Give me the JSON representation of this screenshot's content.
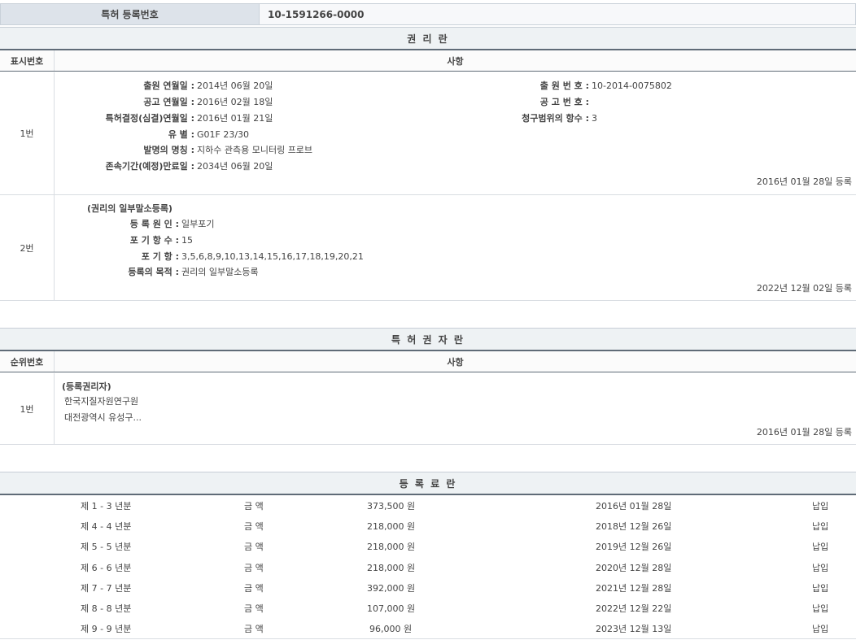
{
  "header": {
    "label": "특허 등록번호",
    "value": "10-1591266-0000"
  },
  "rights": {
    "title": "권 리 란",
    "col1": "표시번호",
    "col2": "사항",
    "entry1": {
      "num": "1번",
      "left": [
        {
          "k": "출원 연월일 :",
          "v": "2014년 06월 20일"
        },
        {
          "k": "공고 연월일 :",
          "v": "2016년 02월 18일"
        },
        {
          "k": "특허결정(심결)연월일 :",
          "v": "2016년 01월 21일"
        },
        {
          "k": "유 별 :",
          "v": "G01F 23/30"
        },
        {
          "k": "발명의 명칭 :",
          "v": "지하수 관측용 모니터링 프로브"
        },
        {
          "k": "존속기간(예정)만료일 :",
          "v": "2034년 06월 20일"
        }
      ],
      "right": [
        {
          "k": "출 원 번 호 :",
          "v": "10-2014-0075802"
        },
        {
          "k": "공 고 번 호 :",
          "v": ""
        },
        {
          "k": "청구범위의 항수 :",
          "v": "3"
        }
      ],
      "stamp": "2016년 01월 28일 등록"
    },
    "entry2": {
      "num": "2번",
      "heading": "(권리의 일부말소등록)",
      "items": [
        {
          "k": "등 록 원 인 :",
          "v": "일부포기"
        },
        {
          "k": "포 기 항 수 :",
          "v": "15"
        },
        {
          "k": "포 기 항 :",
          "v": "3,5,6,8,9,10,13,14,15,16,17,18,19,20,21"
        },
        {
          "k": "등록의 목적 :",
          "v": "권리의 일부말소등록"
        }
      ],
      "stamp": "2022년 12월 02일 등록"
    }
  },
  "holders": {
    "title": "특 허 권 자 란",
    "col1": "순위번호",
    "col2": "사항",
    "entry1": {
      "num": "1번",
      "heading": "(등록권리자)",
      "name": "한국지질자원연구원",
      "address": "대전광역시 유성구...",
      "stamp": "2016년 01월 28일 등록"
    }
  },
  "fees": {
    "title": "등 록 료 란",
    "rows": [
      {
        "period": "제 1 - 3 년분",
        "label": "금 액",
        "amount": "373,500 원",
        "date": "2016년 01월 28일",
        "status": "납입"
      },
      {
        "period": "제 4 - 4 년분",
        "label": "금 액",
        "amount": "218,000 원",
        "date": "2018년 12월 26일",
        "status": "납입"
      },
      {
        "period": "제 5 - 5 년분",
        "label": "금 액",
        "amount": "218,000 원",
        "date": "2019년 12월 26일",
        "status": "납입"
      },
      {
        "period": "제 6 - 6 년분",
        "label": "금 액",
        "amount": "218,000 원",
        "date": "2020년 12월 28일",
        "status": "납입"
      },
      {
        "period": "제 7 - 7 년분",
        "label": "금 액",
        "amount": "392,000 원",
        "date": "2021년 12월 28일",
        "status": "납입"
      },
      {
        "period": "제 8 - 8 년분",
        "label": "금 액",
        "amount": "107,000 원",
        "date": "2022년 12월 22일",
        "status": "납입"
      },
      {
        "period": "제 9 - 9 년분",
        "label": "금 액",
        "amount": "96,000 원",
        "date": "2023년 12월 13일",
        "status": "납입"
      }
    ]
  }
}
